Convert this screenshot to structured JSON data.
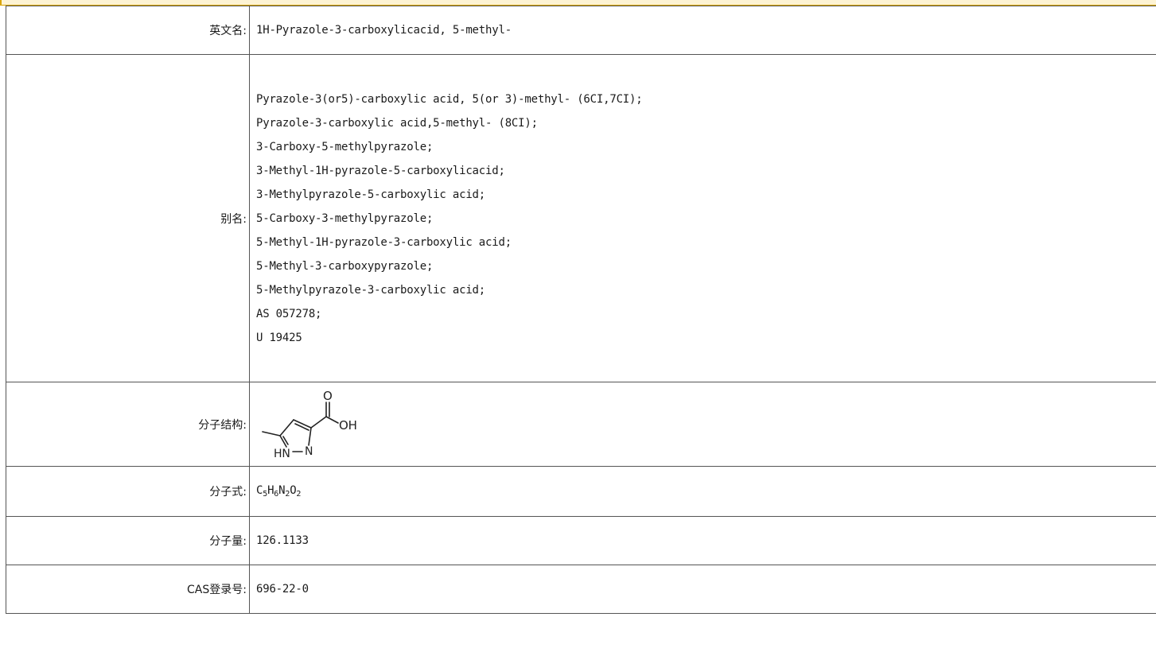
{
  "rows": {
    "english_name": {
      "label": "英文名:",
      "value": "1H-Pyrazole-3-carboxylicacid, 5-methyl-"
    },
    "aliases": {
      "label": "别名:",
      "items": [
        "Pyrazole-3(or5)-carboxylic acid, 5(or 3)-methyl- (6CI,7CI);",
        "Pyrazole-3-carboxylic acid,5-methyl- (8CI);",
        "3-Carboxy-5-methylpyrazole;",
        "3-Methyl-1H-pyrazole-5-carboxylicacid;",
        "3-Methylpyrazole-5-carboxylic acid;",
        "5-Carboxy-3-methylpyrazole;",
        "5-Methyl-1H-pyrazole-3-carboxylic acid;",
        "5-Methyl-3-carboxypyrazole;",
        "5-Methylpyrazole-3-carboxylic acid;",
        "AS 057278;",
        "U 19425"
      ]
    },
    "structure": {
      "label": "分子结构:",
      "atom_labels": {
        "oxygen": "O",
        "hydroxyl": "OH",
        "nh": "HN",
        "n": "N"
      }
    },
    "formula": {
      "label": "分子式:",
      "parts": {
        "c": "C",
        "c_n": "5",
        "h": "H",
        "h_n": "6",
        "n": "N",
        "n_n": "2",
        "o": "O",
        "o_n": "2"
      }
    },
    "molecular_weight": {
      "label": "分子量:",
      "value": "126.1133"
    },
    "cas": {
      "label": "CAS登录号:",
      "value": "696-22-0"
    }
  },
  "colors": {
    "top_bar": "#fdf3d3",
    "top_bar_border": "#d9a400",
    "grid": "#555555"
  }
}
